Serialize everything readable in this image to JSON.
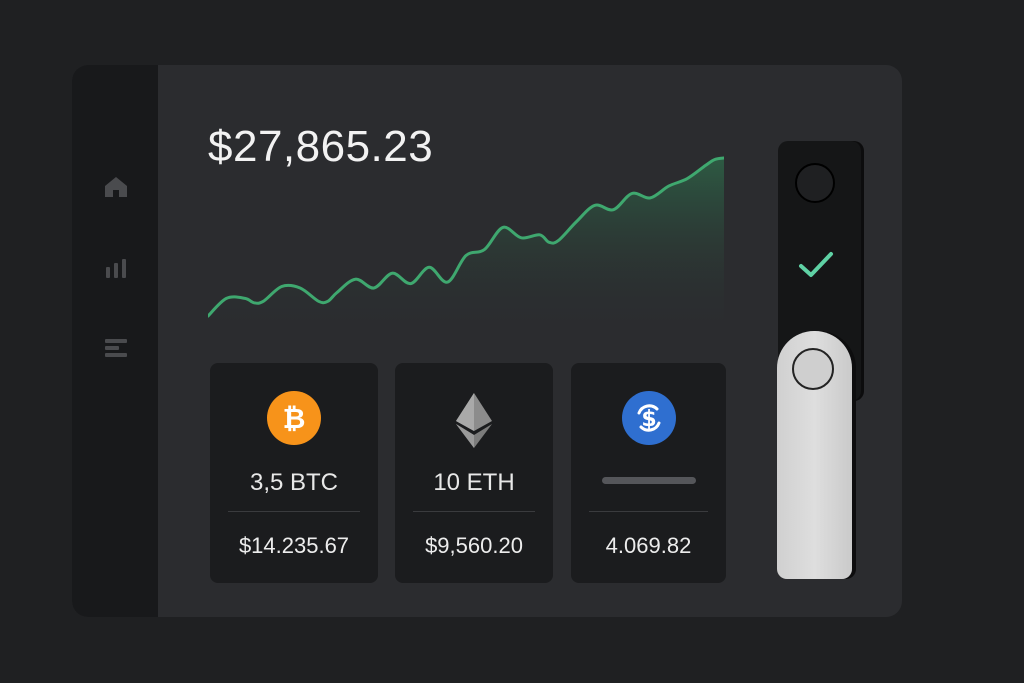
{
  "portfolio": {
    "balance": "$27,865.23"
  },
  "nav": {
    "items": [
      {
        "icon": "home-icon"
      },
      {
        "icon": "bar-chart-icon"
      },
      {
        "icon": "menu-icon"
      }
    ]
  },
  "chart_data": {
    "type": "area",
    "title": "",
    "xlabel": "",
    "ylabel": "",
    "grid": false,
    "x": [
      0,
      2,
      4,
      5,
      6,
      8,
      10,
      12,
      13,
      14,
      16,
      18,
      20,
      22,
      24,
      26,
      28,
      30,
      32,
      34,
      36,
      37,
      38,
      40,
      42,
      44,
      46,
      48,
      50,
      52,
      54,
      55,
      56
    ],
    "values": [
      4,
      16,
      16,
      13,
      14,
      24,
      23,
      14,
      14,
      20,
      29,
      23,
      33,
      26,
      37,
      27,
      45,
      49,
      64,
      57,
      59,
      54,
      55,
      68,
      79,
      76,
      87,
      84,
      92,
      97,
      106,
      110,
      111
    ],
    "line_color": "#3fa86f",
    "fill_color": "#2e6a4a"
  },
  "assets": [
    {
      "icon": "bitcoin-icon",
      "symbol_glyph": "₿",
      "color": "#f7931a",
      "amount": "3,5 BTC",
      "value": "$14.235.67"
    },
    {
      "icon": "ethereum-icon",
      "color": "#8a8a8a",
      "amount": "10 ETH",
      "value": "$9,560.20"
    },
    {
      "icon": "usdc-icon",
      "symbol_glyph": "$",
      "color": "#2f6fd0",
      "amount": "",
      "value": "4.069.82"
    }
  ],
  "device": {
    "status_icon": "check-icon",
    "accent": "#5fd2a5"
  }
}
